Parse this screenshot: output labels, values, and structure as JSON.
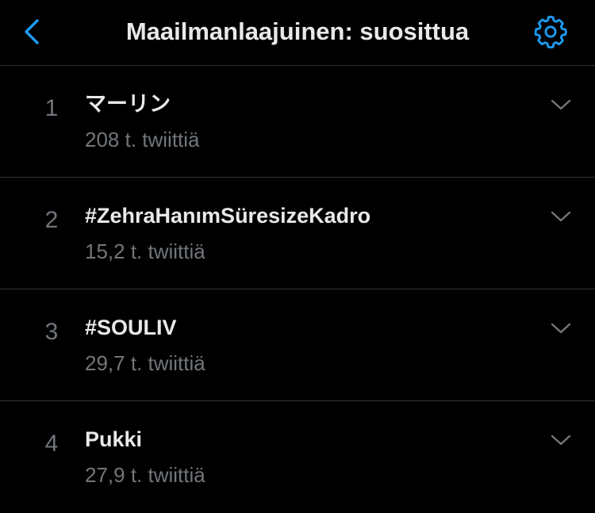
{
  "header": {
    "back_icon": "chevron-left-icon",
    "title": "Maailmanlaajuinen: suosittua",
    "settings_icon": "gear-icon"
  },
  "colors": {
    "background": "#000000",
    "accent": "#1d9bf0",
    "primary_text": "#e7e9ea",
    "secondary_text": "#71767b",
    "divider": "#2f3336"
  },
  "trends": [
    {
      "rank": "1",
      "name": "マーリン",
      "count": "208 t. twiittiä",
      "more_icon": "chevron-down-icon"
    },
    {
      "rank": "2",
      "name": "#ZehraHanımSüresizeKadro",
      "count": "15,2 t. twiittiä",
      "more_icon": "chevron-down-icon"
    },
    {
      "rank": "3",
      "name": "#SOULIV",
      "count": "29,7 t. twiittiä",
      "more_icon": "chevron-down-icon"
    },
    {
      "rank": "4",
      "name": "Pukki",
      "count": "27,9 t. twiittiä",
      "more_icon": "chevron-down-icon"
    }
  ]
}
